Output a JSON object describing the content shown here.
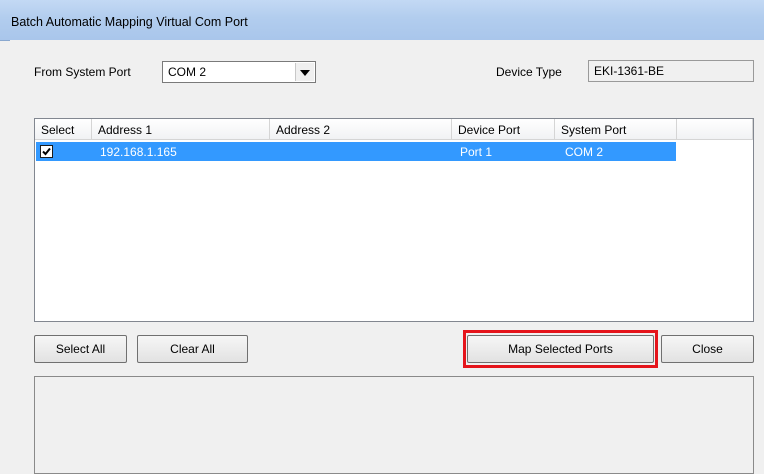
{
  "window": {
    "title": "Batch Automatic Mapping Virtual Com Port"
  },
  "form": {
    "from_system_port_label": "From System Port",
    "from_system_port_value": "COM 2",
    "device_type_label": "Device Type",
    "device_type_value": "EKI-1361-BE"
  },
  "list": {
    "columns": [
      "Select",
      "Address 1",
      "Address 2",
      "Device Port",
      "System Port"
    ],
    "rows": [
      {
        "selected": true,
        "address1": "192.168.1.165",
        "address2": "",
        "device_port": "Port 1",
        "system_port": "COM 2"
      }
    ]
  },
  "buttons": {
    "select_all": "Select All",
    "clear_all": "Clear All",
    "map_selected_ports": "Map Selected Ports",
    "close": "Close"
  },
  "colors": {
    "selection": "#3399ff",
    "highlight_box": "#e5141b",
    "titlebar": "#b2cdee"
  }
}
